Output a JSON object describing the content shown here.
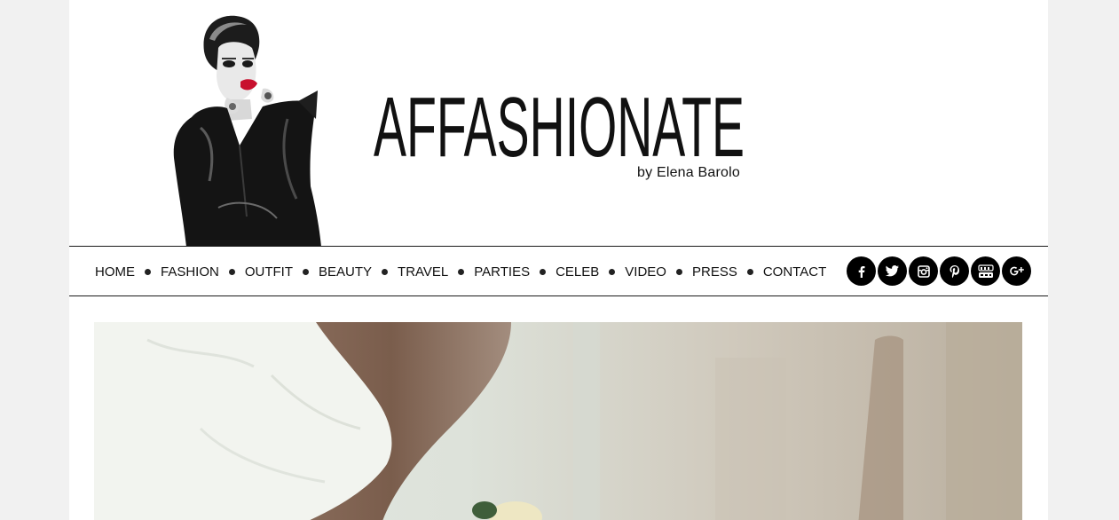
{
  "header": {
    "logo_text": "AFFASHIONATE",
    "byline": "by Elena Barolo"
  },
  "nav": {
    "items": [
      {
        "label": "HOME"
      },
      {
        "label": "FASHION"
      },
      {
        "label": "OUTFIT"
      },
      {
        "label": "BEAUTY"
      },
      {
        "label": "TRAVEL"
      },
      {
        "label": "PARTIES"
      },
      {
        "label": "CELEB"
      },
      {
        "label": "VIDEO"
      },
      {
        "label": "PRESS"
      },
      {
        "label": "CONTACT"
      }
    ]
  },
  "social": {
    "icons": [
      "facebook-icon",
      "twitter-icon",
      "instagram-icon",
      "pinterest-icon",
      "youtube-icon",
      "google-plus-icon"
    ]
  },
  "colors": {
    "background": "#f1f1f1",
    "page": "#ffffff",
    "text": "#111111",
    "social_bg": "#000000",
    "lip_red": "#c8102e"
  }
}
